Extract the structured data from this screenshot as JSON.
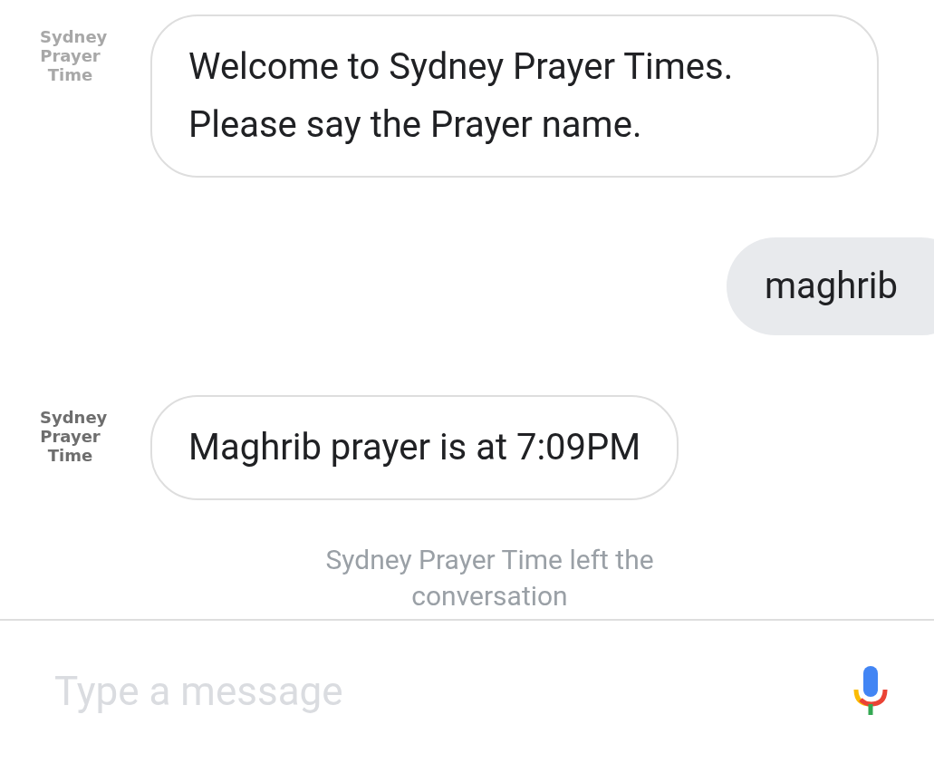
{
  "messages": [
    {
      "kind": "bot",
      "sender": "Sydney Prayer Time",
      "faded": true,
      "text": "Welcome to Sydney Prayer Times. Please say the Prayer name."
    },
    {
      "kind": "user",
      "text": "maghrib"
    },
    {
      "kind": "bot",
      "sender": "Sydney Prayer Time",
      "faded": false,
      "text": "Maghrib prayer is at 7:09PM"
    },
    {
      "kind": "system",
      "text": "Sydney Prayer Time left the conversation"
    }
  ],
  "composer": {
    "placeholder": "Type a message"
  }
}
